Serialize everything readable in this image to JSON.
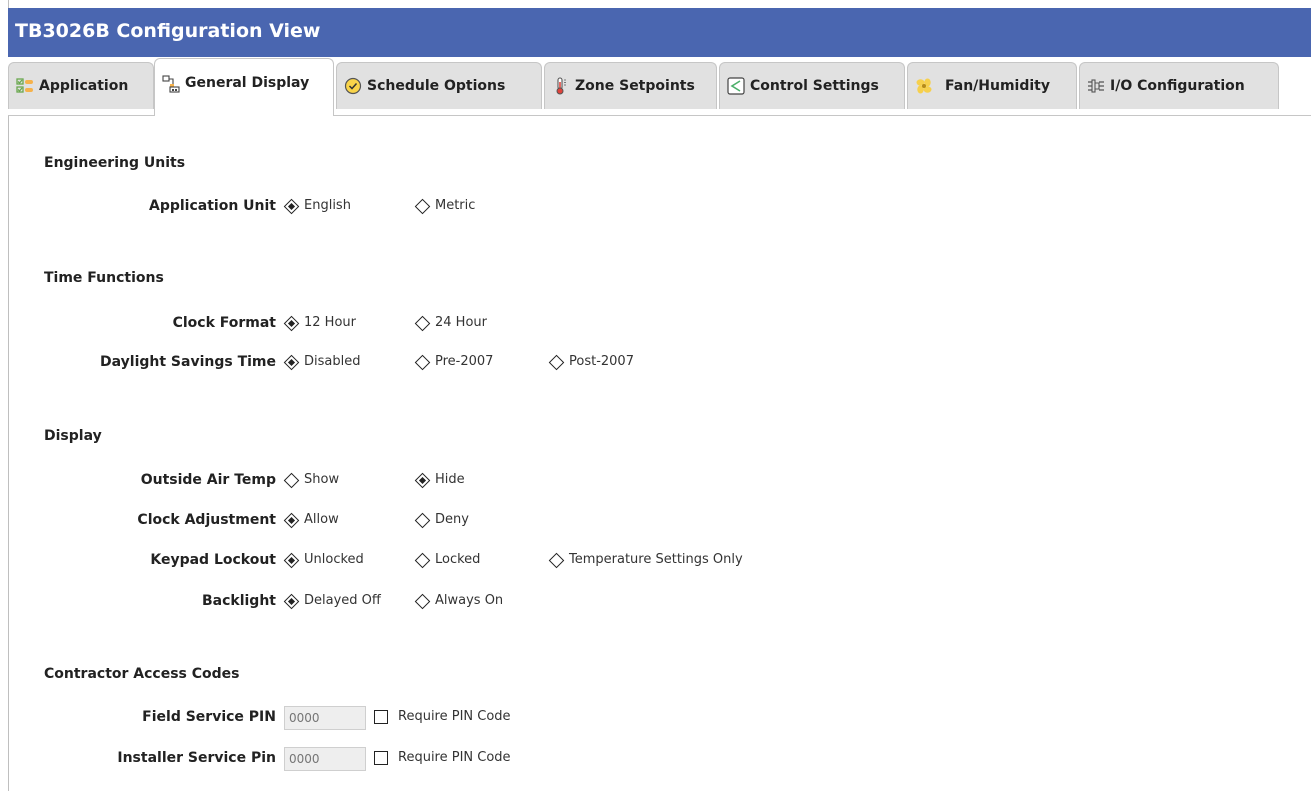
{
  "window": {
    "title": "TB3026B Configuration View"
  },
  "tabs": [
    {
      "label": "Application",
      "icon": "checklist-icon",
      "active": false
    },
    {
      "label": "General Display",
      "icon": "display-settings-icon",
      "active": true
    },
    {
      "label": "Schedule Options",
      "icon": "schedule-clock-icon",
      "active": false
    },
    {
      "label": "Zone Setpoints",
      "icon": "thermometer-icon",
      "active": false
    },
    {
      "label": "Control Settings",
      "icon": "control-settings-icon",
      "active": false
    },
    {
      "label": "Fan/Humidity",
      "icon": "fan-icon",
      "active": false
    },
    {
      "label": "I/O Configuration",
      "icon": "io-configuration-icon",
      "active": false
    }
  ],
  "engineering_units": {
    "title": "Engineering Units",
    "application_unit": {
      "label": "Application Unit",
      "options": [
        "English",
        "Metric"
      ],
      "selected": "English"
    }
  },
  "time_functions": {
    "title": "Time Functions",
    "clock_format": {
      "label": "Clock Format",
      "options": [
        "12 Hour",
        "24 Hour"
      ],
      "selected": "12 Hour"
    },
    "daylight_savings": {
      "label": "Daylight Savings Time",
      "options": [
        "Disabled",
        "Pre-2007",
        "Post-2007"
      ],
      "selected": "Disabled"
    }
  },
  "display": {
    "title": "Display",
    "outside_air_temp": {
      "label": "Outside Air Temp",
      "options": [
        "Show",
        "Hide"
      ],
      "selected": "Hide"
    },
    "clock_adjustment": {
      "label": "Clock Adjustment",
      "options": [
        "Allow",
        "Deny"
      ],
      "selected": "Allow"
    },
    "keypad_lockout": {
      "label": "Keypad Lockout",
      "options": [
        "Unlocked",
        "Locked",
        "Temperature Settings Only"
      ],
      "selected": "Unlocked"
    },
    "backlight": {
      "label": "Backlight",
      "options": [
        "Delayed Off",
        "Always On"
      ],
      "selected": "Delayed Off"
    }
  },
  "contractor_access": {
    "title": "Contractor Access Codes",
    "field_service": {
      "label": "Field Service PIN",
      "placeholder": "0000",
      "require_label": "Require PIN Code",
      "checked": false
    },
    "installer_service": {
      "label": "Installer Service Pin",
      "placeholder": "0000",
      "require_label": "Require PIN Code",
      "checked": false
    }
  },
  "colors": {
    "titlebar": "#4a66b0",
    "tab_inactive": "#e1e1e1",
    "tab_active": "#ffffff"
  }
}
